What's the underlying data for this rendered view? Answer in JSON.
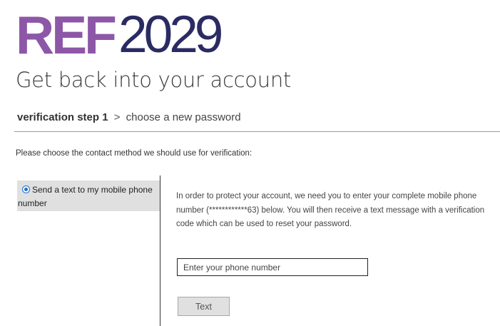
{
  "logo": {
    "brand": "REF",
    "year": "2029",
    "brand_color": "#8d57a7",
    "year_color": "#2b2b63"
  },
  "heading": "Get back into your account",
  "steps": {
    "current": "verification step 1",
    "separator": ">",
    "next": "choose a new password"
  },
  "instruction": "Please choose the contact method we should use for verification:",
  "options": [
    {
      "label": "Send a text to my mobile phone number",
      "selected": true
    }
  ],
  "panel": {
    "description": "In order to protect your account, we need you to enter your complete mobile phone number (************63) below. You will then receive a text message with a verification code which can be used to reset your password.",
    "phone_placeholder": "Enter your phone number",
    "phone_value": "",
    "button_label": "Text"
  },
  "colors": {
    "accent": "#1f6fd1",
    "option_background": "#e0e0e0"
  }
}
